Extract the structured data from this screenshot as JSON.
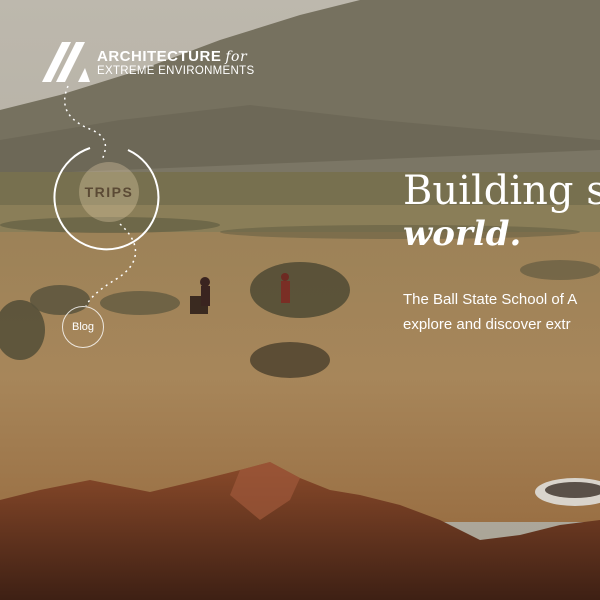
{
  "brand": {
    "title_main": "ARCHITECTURE",
    "title_for": "for",
    "subtitle": "EXTREME ENVIRONMENTS"
  },
  "nav": {
    "trips_label": "TRIPS",
    "blog_label": "Blog"
  },
  "hero": {
    "headline_line1": "Building st",
    "headline_line2": "world.",
    "body_line1": "The Ball State School of A",
    "body_line2": "explore and discover extr"
  },
  "colors": {
    "sky": "#b9b3a6",
    "mountain": "#6f6a5c",
    "sand": "#a8875a",
    "dune_red": "#6b3520",
    "text": "#ffffff"
  }
}
